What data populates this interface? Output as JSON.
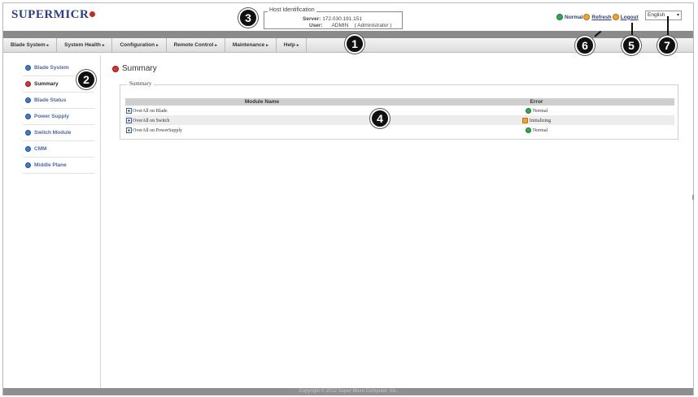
{
  "brand": {
    "logo_text": "SUPERMICR"
  },
  "host_identification": {
    "legend": "Host Identification",
    "server_label": "Server:",
    "server_value": "172.030.191.151",
    "user_label": "User:",
    "user_value": "ADMIN",
    "user_role": "( Administrator )"
  },
  "header": {
    "status_label": "Normal",
    "refresh_label": "Refresh",
    "logout_label": "Logout",
    "language": {
      "selected": "English",
      "arrow": "▾"
    }
  },
  "menu": {
    "items": [
      {
        "label": "Blade System",
        "arrow": "▸"
      },
      {
        "label": "System Health",
        "arrow": "▸"
      },
      {
        "label": "Configuration",
        "arrow": "▸"
      },
      {
        "label": "Remote Control",
        "arrow": "▸"
      },
      {
        "label": "Maintenance",
        "arrow": "▸"
      },
      {
        "label": "Help",
        "arrow": "▸"
      }
    ]
  },
  "sidebar": {
    "items": [
      {
        "label": "Blade System",
        "icon": "blue-circle-icon"
      },
      {
        "label": "Summary",
        "icon": "red-circle-icon",
        "active": true
      },
      {
        "label": "Blade Status",
        "icon": "blue-circle-icon"
      },
      {
        "label": "Power Supply",
        "icon": "blue-circle-icon"
      },
      {
        "label": "Switch Module",
        "icon": "blue-circle-icon"
      },
      {
        "label": "CMM",
        "icon": "blue-circle-icon"
      },
      {
        "label": "Middle Plane",
        "icon": "blue-circle-icon"
      }
    ]
  },
  "main": {
    "title": "Summary",
    "fieldset_legend": "Summary",
    "table": {
      "headers": [
        "Module Name",
        "Error"
      ],
      "rows": [
        {
          "module": "OverAll on Blade",
          "error": "Normal",
          "status": "ok"
        },
        {
          "module": "OverAll on Switch",
          "error": "Initializing",
          "status": "init"
        },
        {
          "module": "OverAll on PowerSupply",
          "error": "Normal",
          "status": "ok"
        }
      ]
    }
  },
  "footer": {
    "text": "Copyright © 2012 Super Micro Computer, Inc."
  },
  "callouts": [
    "1",
    "2",
    "3",
    "4",
    "5",
    "6",
    "7"
  ],
  "colors": {
    "brand_blue": "#2a3e8c",
    "brand_red": "#d0251f",
    "status_green": "#2fa84f",
    "status_orange": "#f0a428",
    "menu_bar": "#8a8a8a",
    "table_header": "#cfcfcf"
  }
}
